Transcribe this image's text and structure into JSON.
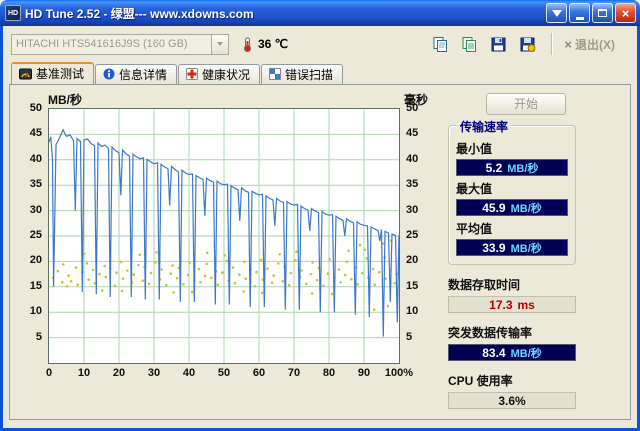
{
  "window": {
    "title": "HD Tune 2.52 - 绿盟--- www.xdowns.com"
  },
  "titlebar": {
    "buttons": [
      {
        "name": "download-button",
        "icon": "download-icon"
      },
      {
        "name": "minimize-button",
        "icon": "minimize-icon"
      },
      {
        "name": "maximize-button",
        "icon": "maximize-icon"
      },
      {
        "name": "close-button",
        "icon": "close-icon",
        "glyph": "×"
      }
    ]
  },
  "toolbar": {
    "drive": "HITACHI HTS541616J9S (160 GB)",
    "temperature": "36 ℃",
    "exit_label": "退出(X)",
    "exit_icon_glyph": "×",
    "buttons": [
      {
        "name": "copy",
        "icon": "copy-pages-icon"
      },
      {
        "name": "copy-image",
        "icon": "copy-image-icon"
      },
      {
        "name": "save",
        "icon": "floppy-icon"
      },
      {
        "name": "export",
        "icon": "floppy-export-icon"
      }
    ]
  },
  "tabs": [
    {
      "label": "基准测试",
      "icon": "benchmark-icon",
      "active": true
    },
    {
      "label": "信息详情",
      "icon": "info-icon",
      "active": false
    },
    {
      "label": "健康状况",
      "icon": "health-icon",
      "active": false
    },
    {
      "label": "错误扫描",
      "icon": "scan-icon",
      "active": false
    }
  ],
  "panel": {
    "start_label": "开始",
    "transfer": {
      "title": "传输速率",
      "rows": [
        {
          "label": "最小值",
          "value": "5.2",
          "unit": "MB/秒"
        },
        {
          "label": "最大值",
          "value": "45.9",
          "unit": "MB/秒"
        },
        {
          "label": "平均值",
          "value": "33.9",
          "unit": "MB/秒"
        }
      ]
    },
    "access": {
      "label": "数据存取时间",
      "value": "17.3",
      "unit": "ms"
    },
    "burst": {
      "label": "突发数据传输率",
      "value": "83.4",
      "unit": "MB/秒"
    },
    "cpu": {
      "label": "CPU 使用率",
      "value": "3.6%"
    }
  },
  "colors": {
    "badge_bg": "#000055",
    "badge_value": "#ffffff",
    "badge_unit": "#6fd4ff",
    "access_value": "#b00000",
    "titlebar_accent": "#2a63e0"
  },
  "chart_data": {
    "type": "line+scatter",
    "title": "HD Tune benchmark: transfer rate (line, MB/s) and access time (scatter, ms) vs disk position %",
    "left_axis_label": "MB/秒",
    "right_axis_label": "毫秒",
    "x_range": [
      0,
      100
    ],
    "y_range": [
      0,
      50
    ],
    "grid": {
      "x_step": 10,
      "y_step": 5,
      "on": true
    },
    "y_ticks": [
      50,
      45,
      40,
      35,
      30,
      25,
      20,
      15,
      10,
      5
    ],
    "x_ticks": [
      [
        0,
        "0"
      ],
      [
        10,
        "10"
      ],
      [
        20,
        "20"
      ],
      [
        30,
        "30"
      ],
      [
        40,
        "40"
      ],
      [
        50,
        "50"
      ],
      [
        60,
        "60"
      ],
      [
        70,
        "70"
      ],
      [
        80,
        "80"
      ],
      [
        90,
        "90"
      ],
      [
        100,
        "100%"
      ]
    ],
    "colors": {
      "grid": "#aed2ae",
      "line": "#3c78c8",
      "scatter": "#c6c61e",
      "plot_bg": "#ffffff"
    },
    "series": [
      {
        "name": "transfer_rate",
        "type": "line",
        "color": "#3c78c8",
        "points": [
          [
            0,
            43.5
          ],
          [
            0.5,
            44.5
          ],
          [
            1,
            40
          ],
          [
            1.3,
            15
          ],
          [
            2,
            43
          ],
          [
            3,
            44.3
          ],
          [
            4,
            45.9
          ],
          [
            5,
            44.6
          ],
          [
            6,
            44.9
          ],
          [
            7,
            43.8
          ],
          [
            7.5,
            30
          ],
          [
            8,
            44.2
          ],
          [
            9,
            43.6
          ],
          [
            9.5,
            14
          ],
          [
            10,
            43.9
          ],
          [
            11,
            44.1
          ],
          [
            12,
            43.2
          ],
          [
            13,
            42.8
          ],
          [
            13.5,
            13.5
          ],
          [
            14,
            43.3
          ],
          [
            15,
            42.6
          ],
          [
            16,
            42.9
          ],
          [
            17,
            42.2
          ],
          [
            17.5,
            13
          ],
          [
            18,
            42.5
          ],
          [
            19,
            41.8
          ],
          [
            20,
            41.4
          ],
          [
            20.5,
            33
          ],
          [
            21,
            41.9
          ],
          [
            22,
            41.2
          ],
          [
            23,
            40.7
          ],
          [
            23.5,
            13
          ],
          [
            24,
            41.1
          ],
          [
            25,
            40.6
          ],
          [
            26,
            40.2
          ],
          [
            27,
            40.4
          ],
          [
            27.5,
            12.5
          ],
          [
            28,
            40.1
          ],
          [
            29,
            39.6
          ],
          [
            30,
            39.2
          ],
          [
            31,
            39.4
          ],
          [
            31.5,
            12.5
          ],
          [
            32,
            39.1
          ],
          [
            33,
            38.6
          ],
          [
            34,
            38.2
          ],
          [
            34.5,
            31
          ],
          [
            35,
            38.7
          ],
          [
            36,
            38.1
          ],
          [
            37,
            37.6
          ],
          [
            37.5,
            12
          ],
          [
            38,
            38
          ],
          [
            39,
            37.4
          ],
          [
            40,
            37.1
          ],
          [
            41,
            37.2
          ],
          [
            41.5,
            12
          ],
          [
            42,
            36.9
          ],
          [
            43,
            36.5
          ],
          [
            44,
            36.1
          ],
          [
            44.5,
            29
          ],
          [
            45,
            36.4
          ],
          [
            46,
            35.9
          ],
          [
            47,
            35.6
          ],
          [
            47.5,
            11.5
          ],
          [
            48,
            35.8
          ],
          [
            49,
            35.3
          ],
          [
            50,
            35.1
          ],
          [
            51,
            35.2
          ],
          [
            51.5,
            11.5
          ],
          [
            52,
            34.9
          ],
          [
            53,
            34.4
          ],
          [
            54,
            34.1
          ],
          [
            54.5,
            28
          ],
          [
            55,
            34.5
          ],
          [
            56,
            33.9
          ],
          [
            57,
            33.6
          ],
          [
            57.5,
            11
          ],
          [
            58,
            33.8
          ],
          [
            59,
            33.4
          ],
          [
            60,
            33.1
          ],
          [
            61,
            33.2
          ],
          [
            61.5,
            11
          ],
          [
            62,
            32.9
          ],
          [
            63,
            32.4
          ],
          [
            64,
            32.1
          ],
          [
            64.5,
            27
          ],
          [
            65,
            32.4
          ],
          [
            66,
            31.9
          ],
          [
            67,
            31.6
          ],
          [
            67.5,
            10.5
          ],
          [
            68,
            31.8
          ],
          [
            69,
            31.3
          ],
          [
            70,
            31.1
          ],
          [
            71,
            31.2
          ],
          [
            71.5,
            10.5
          ],
          [
            72,
            30.9
          ],
          [
            73,
            30.4
          ],
          [
            74,
            30.1
          ],
          [
            74.5,
            26
          ],
          [
            75,
            30.4
          ],
          [
            76,
            29.9
          ],
          [
            77,
            29.6
          ],
          [
            77.5,
            10
          ],
          [
            78,
            29.8
          ],
          [
            79,
            29.3
          ],
          [
            80,
            29.1
          ],
          [
            81,
            29.2
          ],
          [
            81.5,
            10
          ],
          [
            82,
            28.9
          ],
          [
            83,
            28.4
          ],
          [
            84,
            28.1
          ],
          [
            84.5,
            25
          ],
          [
            85,
            28.4
          ],
          [
            86,
            27.9
          ],
          [
            87,
            27.6
          ],
          [
            87.5,
            9.5
          ],
          [
            88,
            27.8
          ],
          [
            89,
            27.3
          ],
          [
            90,
            27.1
          ],
          [
            91,
            27
          ],
          [
            91.5,
            9
          ],
          [
            92,
            26.8
          ],
          [
            93,
            26.4
          ],
          [
            94,
            26.1
          ],
          [
            94.5,
            24
          ],
          [
            95,
            26.3
          ],
          [
            95.5,
            5.2
          ],
          [
            96,
            25.9
          ],
          [
            97,
            25.6
          ],
          [
            97.5,
            12
          ],
          [
            98,
            25.4
          ],
          [
            99,
            25.1
          ],
          [
            99.5,
            8
          ],
          [
            100,
            25.2
          ]
        ]
      },
      {
        "name": "access_time",
        "type": "scatter",
        "color": "#c6c61e",
        "points": [
          [
            1.2,
            16.8
          ],
          [
            2.5,
            18.1
          ],
          [
            3.8,
            15.9
          ],
          [
            4.1,
            19.4
          ],
          [
            5.2,
            15.1
          ],
          [
            5.6,
            17.2
          ],
          [
            6.3,
            16.1
          ],
          [
            7.7,
            18.8
          ],
          [
            8.2,
            15.4
          ],
          [
            9.5,
            17.9
          ],
          [
            10.1,
            21.5
          ],
          [
            10.8,
            19.6
          ],
          [
            11.3,
            16.4
          ],
          [
            12.6,
            18.3
          ],
          [
            13.1,
            15.7
          ],
          [
            14.4,
            17.5
          ],
          [
            15.2,
            14.3
          ],
          [
            15.9,
            19.1
          ],
          [
            16.2,
            16.9
          ],
          [
            17.5,
            18.6
          ],
          [
            18.8,
            15.2
          ],
          [
            19.3,
            17.8
          ],
          [
            20.6,
            19.9
          ],
          [
            20.9,
            14.2
          ],
          [
            21.1,
            16.6
          ],
          [
            22.4,
            18.2
          ],
          [
            23.7,
            15.8
          ],
          [
            24.2,
            17.4
          ],
          [
            25.5,
            19.3
          ],
          [
            25.9,
            21.3
          ],
          [
            26.8,
            16.2
          ],
          [
            27.3,
            18.9
          ],
          [
            28.6,
            15.6
          ],
          [
            29.1,
            17.7
          ],
          [
            30.4,
            19.8
          ],
          [
            30.7,
            21.8
          ],
          [
            31.7,
            16.5
          ],
          [
            32.2,
            18.4
          ],
          [
            33.5,
            15.3
          ],
          [
            34.8,
            17.6
          ],
          [
            35.3,
            19.2
          ],
          [
            35.6,
            13.9
          ],
          [
            36.6,
            16.7
          ],
          [
            37.1,
            18.7
          ],
          [
            38.4,
            15.5
          ],
          [
            39.7,
            17.3
          ],
          [
            40.2,
            19.7
          ],
          [
            40.9,
            14.0
          ],
          [
            41.5,
            16.3
          ],
          [
            42.8,
            18.5
          ],
          [
            43.3,
            15.9
          ],
          [
            44.6,
            17.1
          ],
          [
            45.1,
            19.5
          ],
          [
            45.2,
            21.7
          ],
          [
            46.4,
            16.8
          ],
          [
            47.7,
            18.1
          ],
          [
            48.2,
            15.4
          ],
          [
            49.5,
            17.8
          ],
          [
            50.2,
            21.2
          ],
          [
            50.8,
            20.1
          ],
          [
            51.3,
            16.2
          ],
          [
            52.6,
            18.8
          ],
          [
            53.1,
            15.7
          ],
          [
            54.4,
            17.4
          ],
          [
            55.6,
            14.1
          ],
          [
            55.9,
            19.9
          ],
          [
            56.2,
            16.6
          ],
          [
            57.5,
            18.3
          ],
          [
            58.8,
            15.1
          ],
          [
            59.3,
            17.9
          ],
          [
            60.6,
            20.3
          ],
          [
            60.9,
            13.8
          ],
          [
            61.1,
            16.4
          ],
          [
            62.4,
            18.6
          ],
          [
            63.7,
            15.8
          ],
          [
            64.2,
            17.2
          ],
          [
            65.5,
            19.6
          ],
          [
            65.9,
            21.4
          ],
          [
            66.8,
            16.1
          ],
          [
            67.3,
            18.9
          ],
          [
            68.6,
            15.3
          ],
          [
            69.1,
            17.7
          ],
          [
            70.4,
            20.2
          ],
          [
            70.7,
            21.9
          ],
          [
            71.7,
            16.9
          ],
          [
            72.2,
            18.2
          ],
          [
            73.5,
            15.6
          ],
          [
            74.8,
            17.5
          ],
          [
            75.2,
            13.7
          ],
          [
            75.3,
            19.8
          ],
          [
            76.6,
            16.3
          ],
          [
            77.1,
            18.7
          ],
          [
            78.4,
            15.2
          ],
          [
            79.7,
            17.6
          ],
          [
            80.2,
            20.4
          ],
          [
            80.9,
            13.6
          ],
          [
            81.5,
            16.7
          ],
          [
            82.8,
            18.4
          ],
          [
            83.3,
            15.9
          ],
          [
            84.6,
            17.3
          ],
          [
            85.1,
            19.9
          ],
          [
            85.6,
            22.1
          ],
          [
            86.4,
            16.5
          ],
          [
            87.7,
            18.8
          ],
          [
            88.2,
            15.5
          ],
          [
            88.9,
            23.2
          ],
          [
            89.5,
            17.7
          ],
          [
            90.2,
            22.3
          ],
          [
            90.8,
            20.6
          ],
          [
            91.3,
            16.8
          ],
          [
            92.6,
            18.5
          ],
          [
            92.9,
            10.5
          ],
          [
            93.1,
            15.4
          ],
          [
            94.4,
            17.9
          ],
          [
            95.5,
            23.5
          ],
          [
            95.9,
            20.8
          ],
          [
            96.2,
            16.6
          ],
          [
            96.8,
            11.2
          ],
          [
            97.5,
            18.3
          ],
          [
            97.8,
            24.1
          ],
          [
            98.8,
            15.7
          ],
          [
            99.3,
            17.5
          ]
        ]
      }
    ]
  }
}
